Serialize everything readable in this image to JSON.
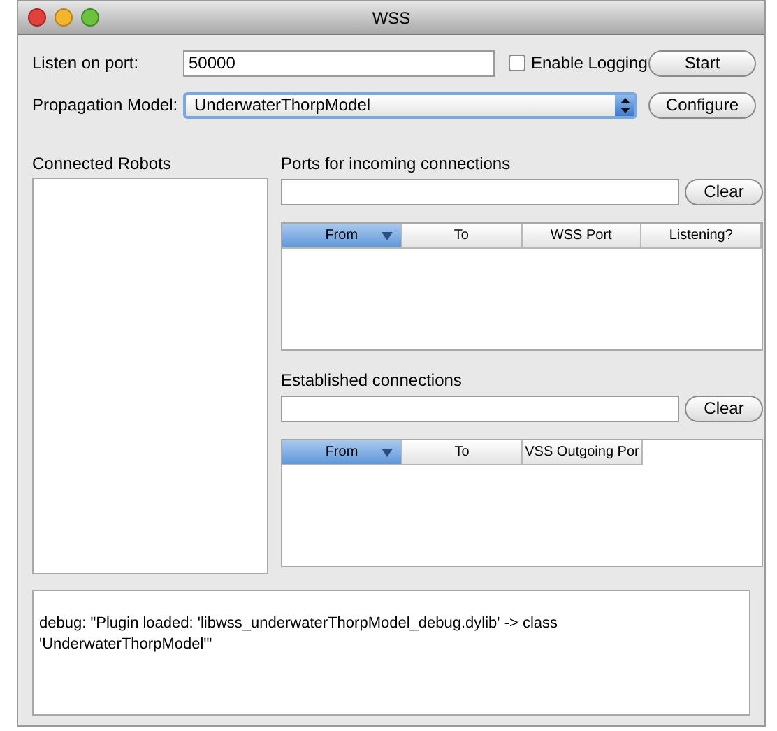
{
  "window": {
    "title": "WSS"
  },
  "port": {
    "label": "Listen on port:",
    "value": "50000"
  },
  "logging": {
    "label": "Enable Logging",
    "checked": false
  },
  "start_button": "Start",
  "model": {
    "label": "Propagation Model:",
    "value": "UnderwaterThorpModel"
  },
  "configure_button": "Configure",
  "robots": {
    "title": "Connected Robots"
  },
  "incoming": {
    "title": "Ports for incoming connections",
    "clear_button": "Clear",
    "columns": [
      {
        "label": "From",
        "selected": true
      },
      {
        "label": "To",
        "selected": false
      },
      {
        "label": "WSS Port",
        "selected": false
      },
      {
        "label": "Listening?",
        "selected": false
      }
    ]
  },
  "established": {
    "title": "Established connections",
    "clear_button": "Clear",
    "columns": [
      {
        "label": "From",
        "selected": true
      },
      {
        "label": "To",
        "selected": false
      },
      {
        "label": "VSS Outgoing Por",
        "selected": false
      }
    ]
  },
  "log": {
    "lines": [
      "debug: \"Plugin loaded: 'libwss_underwaterThorpModel_debug.dylib' -> class",
      "'UnderwaterThorpModel'\""
    ]
  }
}
